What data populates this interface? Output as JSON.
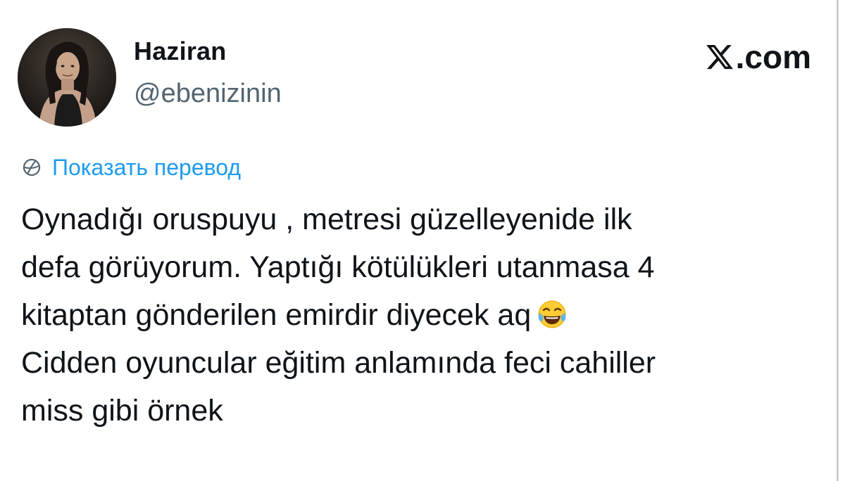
{
  "tweet": {
    "author": {
      "display_name": "Haziran",
      "username": "@ebenizinin",
      "avatar_icon": "profile-photo"
    },
    "brand": {
      "icon": "x-logo-icon",
      "text": ".com"
    },
    "translate": {
      "icon": "globe-icon",
      "label": "Показать перевод",
      "color": "#1d9bf0"
    },
    "lines": [
      "Oynadığı oruspuyu , metresi güzelleyenide ilk",
      "defa görüyorum. Yaptığı kötülükleri utanmasa 4",
      "kitaptan gönderilen emirdir diyecek aq",
      "Cidden oyuncular eğitim anlamında feci cahiller",
      "miss gibi örnek"
    ],
    "emoji": "face-with-tears-of-joy-icon"
  },
  "colors": {
    "text": "#0f1419",
    "secondary": "#536471",
    "link": "#1d9bf0",
    "background": "#ffffff"
  }
}
